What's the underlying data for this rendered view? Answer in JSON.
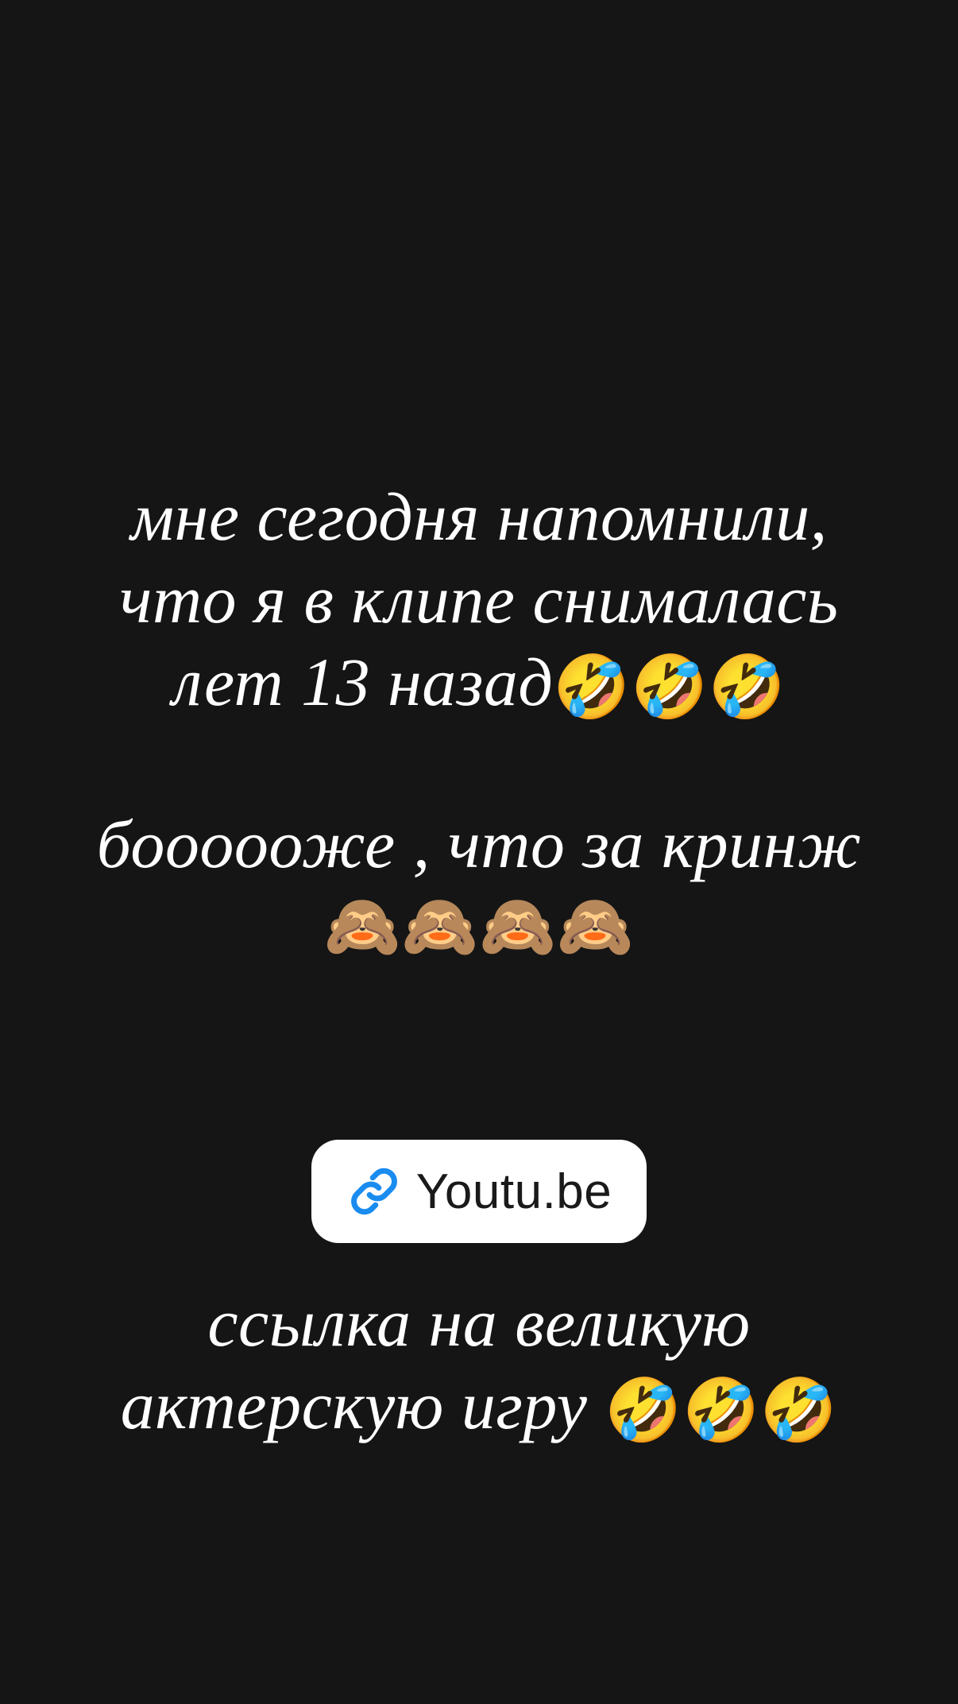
{
  "story": {
    "block1": {
      "lines": [
        "мне сегодня напомнили,",
        "что я в клипе снималась",
        "лет 13 назад"
      ],
      "emoji": "🤣🤣🤣"
    },
    "block2": {
      "lines": [
        "боооооже , что за кринж"
      ],
      "emoji": "🙈🙈🙈🙈"
    },
    "link_sticker": {
      "label": "Youtu.be",
      "icon": "link-icon",
      "icon_color": "#1a8cf0"
    },
    "block3": {
      "lines": [
        "ссылка на великую",
        "актерскую игру "
      ],
      "emoji": "🤣🤣🤣"
    }
  },
  "colors": {
    "background": "#151515",
    "text": "#ffffff",
    "sticker_bg": "#ffffff"
  }
}
